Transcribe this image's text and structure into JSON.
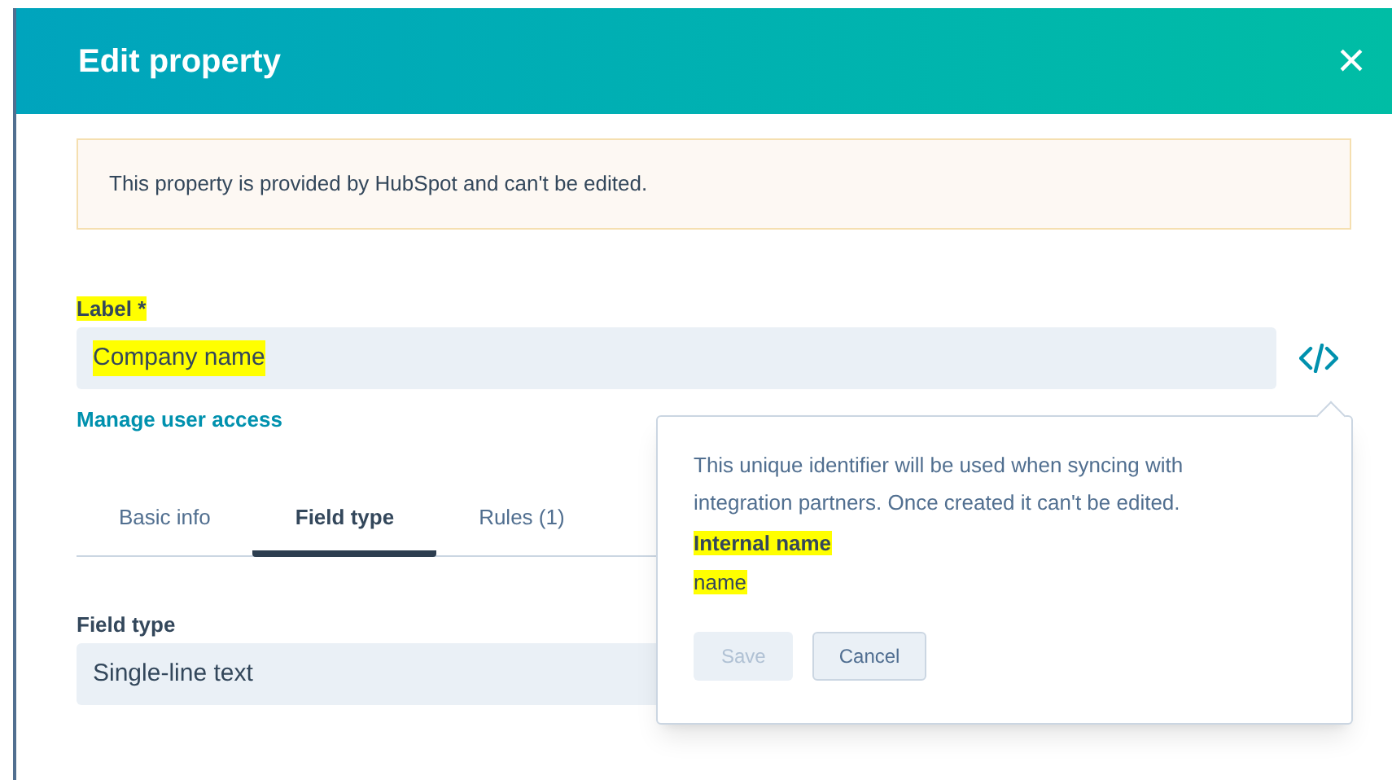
{
  "dialog": {
    "title": "Edit property",
    "close": "×"
  },
  "notice": "This property is provided by HubSpot and can't be edited.",
  "label_field": {
    "label": "Label *",
    "value": "Company name",
    "label_highlighted": true,
    "value_highlighted": true
  },
  "manage_link": "Manage user access",
  "tabs": [
    {
      "label": "Basic info",
      "selected": false
    },
    {
      "label": "Field type",
      "selected": true
    },
    {
      "label": "Rules (1)",
      "selected": false
    }
  ],
  "field_type": {
    "label": "Field type",
    "value": "Single-line text"
  },
  "popover": {
    "description": "This unique identifier will be used when syncing with integration partners. Once created it can't be edited.",
    "internal_name_label": "Internal name",
    "internal_name_value": "name",
    "label_highlighted": true,
    "value_highlighted": true,
    "buttons": [
      {
        "label": "Save",
        "disabled": true
      },
      {
        "label": "Cancel",
        "disabled": false
      }
    ]
  }
}
